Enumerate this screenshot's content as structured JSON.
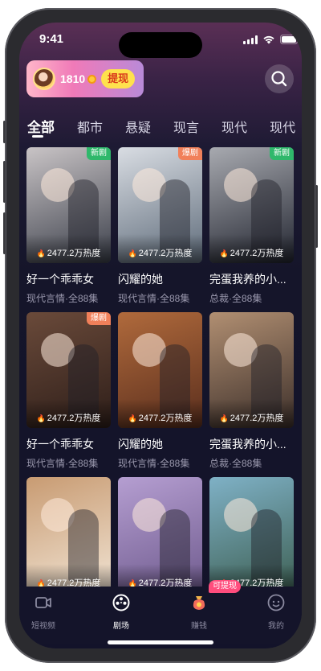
{
  "status_bar": {
    "time": "9:41"
  },
  "header": {
    "coins": "1810",
    "withdraw_label": "提现"
  },
  "tabs": [
    {
      "label": "全部",
      "active": true
    },
    {
      "label": "都市",
      "active": false
    },
    {
      "label": "悬疑",
      "active": false
    },
    {
      "label": "现言",
      "active": false
    },
    {
      "label": "现代",
      "active": false
    },
    {
      "label": "现代",
      "active": false
    }
  ],
  "dramas": [
    {
      "title": "好一个乖乖女",
      "meta": "现代言情·全88集",
      "heat": "2477.2万热度",
      "badge": "新剧",
      "badge_type": "new",
      "colors": [
        "#c9c4c6",
        "#3b3f4a"
      ]
    },
    {
      "title": "闪耀的她",
      "meta": "现代言情·全88集",
      "heat": "2477.2万热度",
      "badge": "爆剧",
      "badge_type": "hot",
      "colors": [
        "#d9dde3",
        "#5e6b7a"
      ]
    },
    {
      "title": "完蛋我养的小...",
      "meta": "总裁·全88集",
      "heat": "2477.2万热度",
      "badge": "新剧",
      "badge_type": "new",
      "colors": [
        "#a8aab0",
        "#222530"
      ]
    },
    {
      "title": "好一个乖乖女",
      "meta": "现代言情·全88集",
      "heat": "2477.2万热度",
      "badge": "爆剧",
      "badge_type": "hot",
      "colors": [
        "#6a4a3a",
        "#2e1e19"
      ]
    },
    {
      "title": "闪耀的她",
      "meta": "现代言情·全88集",
      "heat": "2477.2万热度",
      "badge": "",
      "badge_type": "",
      "colors": [
        "#b06a3c",
        "#5a2e1d"
      ]
    },
    {
      "title": "完蛋我养的小...",
      "meta": "总裁·全88集",
      "heat": "2477.2万热度",
      "badge": "",
      "badge_type": "",
      "colors": [
        "#b18f72",
        "#3c2f2a"
      ]
    },
    {
      "title": "",
      "meta": "",
      "heat": "2477.2万热度",
      "badge": "",
      "badge_type": "",
      "colors": [
        "#c89b72",
        "#f1e4d4"
      ]
    },
    {
      "title": "",
      "meta": "",
      "heat": "2477.2万热度",
      "badge": "",
      "badge_type": "",
      "colors": [
        "#b59ed1",
        "#6f5b8e"
      ]
    },
    {
      "title": "",
      "meta": "",
      "heat": "2477.2万热度",
      "badge": "",
      "badge_type": "",
      "colors": [
        "#7fb1c6",
        "#3d5f52"
      ]
    }
  ],
  "bottom_nav": [
    {
      "label": "短视频",
      "icon": "video-icon",
      "active": false
    },
    {
      "label": "剧场",
      "icon": "theater-reel-icon",
      "active": true
    },
    {
      "label": "赚钱",
      "icon": "money-bag-icon",
      "active": false
    },
    {
      "label": "我的",
      "icon": "profile-face-icon",
      "active": false
    }
  ],
  "earn_tag": "可提现",
  "colors": {
    "accent_yellow": "#ffe14d",
    "new_badge": "#2fb86b",
    "hot_badge": "#f1805a",
    "earn_pill": "#ff4d7d"
  }
}
